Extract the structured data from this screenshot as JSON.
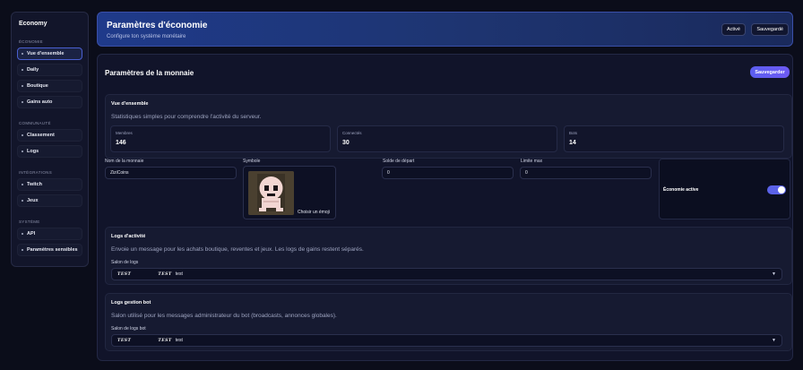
{
  "sidebar": {
    "title": "Economy",
    "sections": [
      {
        "label": "ÉCONOMIE",
        "items": [
          "Vue d'ensemble",
          "Daily",
          "Boutique",
          "Gains auto"
        ]
      },
      {
        "label": "COMMUNAUTÉ",
        "items": [
          "Classement",
          "Logs"
        ]
      },
      {
        "label": "INTÉGRATIONS",
        "items": [
          "Twitch",
          "Jeux"
        ]
      },
      {
        "label": "SYSTÈME",
        "items": [
          "API",
          "Paramètres sensibles"
        ]
      }
    ],
    "active_item": "Vue d'ensemble"
  },
  "header": {
    "title": "Paramètres d'économie",
    "subtitle": "Configure ton système monétaire",
    "status_label": "Activé",
    "saved_label": "Sauvegardé"
  },
  "main": {
    "title": "Paramètres de la monnaie",
    "save_label": "Sauvegarder",
    "overview": {
      "title": "Vue d'ensemble",
      "description": "Statistiques simples pour comprendre l'activité du serveur.",
      "stats": [
        {
          "label": "Membres",
          "value": "146"
        },
        {
          "label": "Connectés",
          "value": "30"
        },
        {
          "label": "Bots",
          "value": "14"
        }
      ]
    },
    "currency": {
      "name_label": "Nom de la monnaie",
      "name_value": "ZiziCoins",
      "symbol_label": "Symbole",
      "symbol_caption": "Choisir un émoji",
      "start_label": "Solde de départ",
      "start_value": "0",
      "limit_label": "Limite max",
      "limit_value": "0",
      "economy_active_label": "Économie active",
      "economy_active": true
    },
    "activity_logs": {
      "title": "Logs d'activité",
      "description": "Envoie un message pour les achats boutique, reventes et jeux. Les logs de gains restent séparés.",
      "channel_label": "Salon de logs",
      "channel_glyph": "𝑻𝑬𝑺𝑻",
      "channel_glyph2": "𝑻𝑬𝑺𝑻",
      "channel_value": "test"
    },
    "bot_logs": {
      "title": "Logs gestion bot",
      "description": "Salon utilisé pour les messages administrateur du bot (broadcasts, annonces globales).",
      "channel_label": "Salon de logs bot",
      "channel_glyph": "𝑻𝑬𝑺𝑻",
      "channel_glyph2": "𝑻𝑬𝑺𝑻",
      "channel_value": "test"
    }
  },
  "colors": {
    "background": "#0b0d1a",
    "accent": "#5b5ef0",
    "header_gradient_start": "#1f3a8a"
  }
}
